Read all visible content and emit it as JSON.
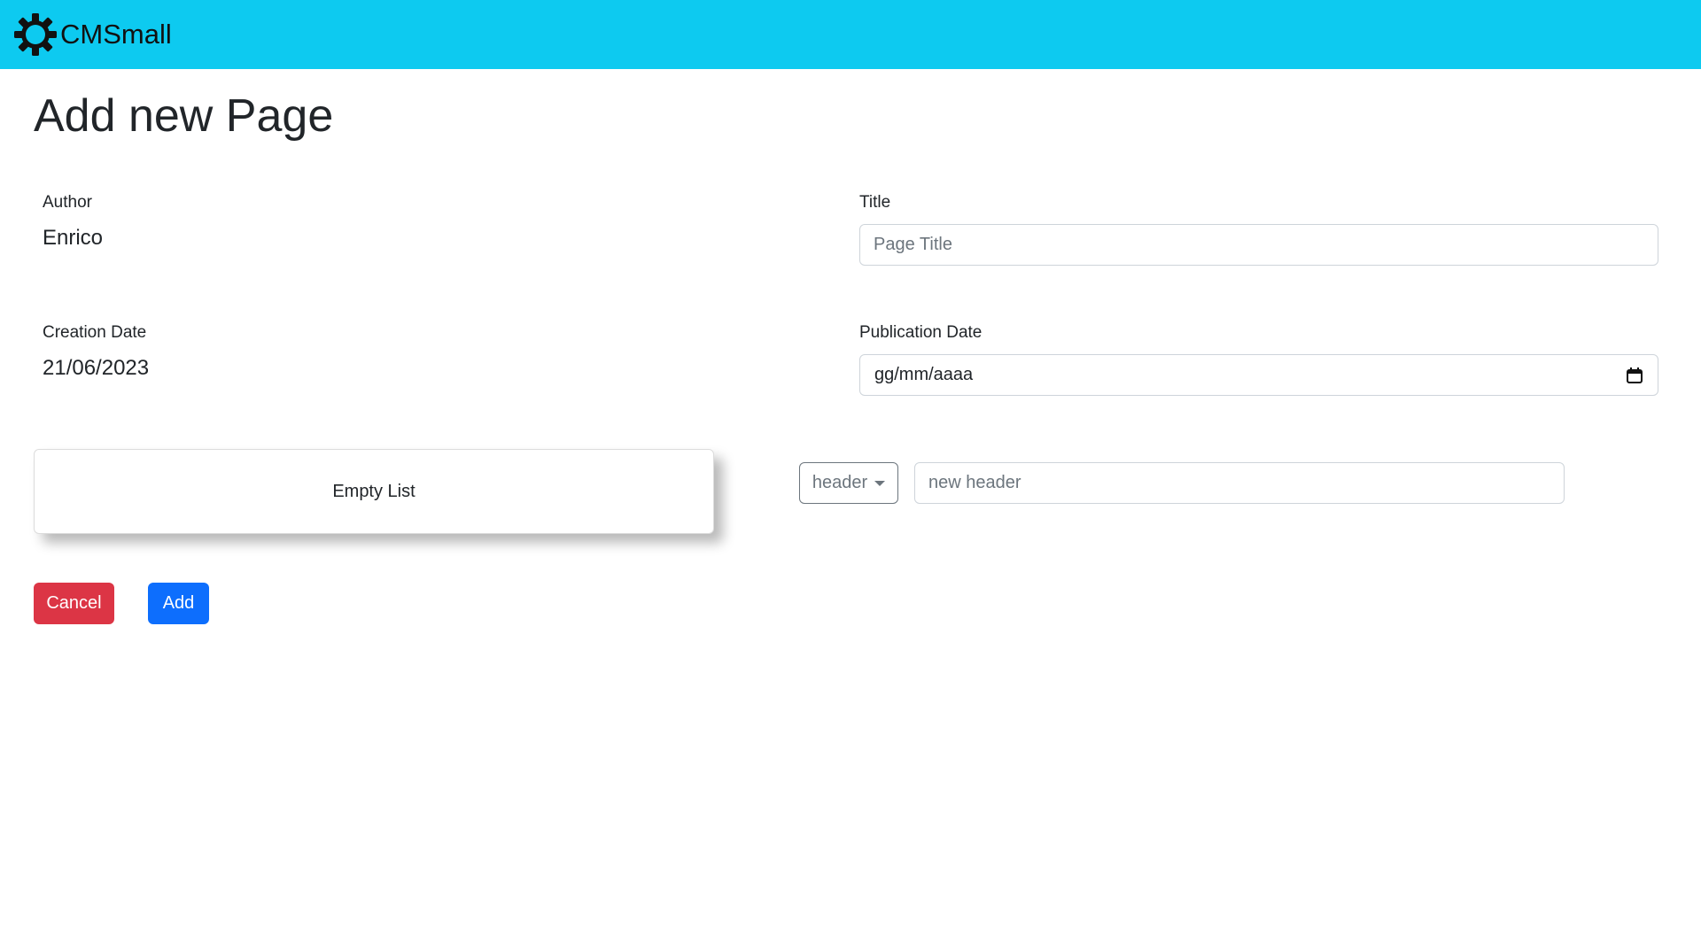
{
  "navbar": {
    "brand": "CMSmall",
    "logo_icon": "gear-icon",
    "background": "#0dcaf0"
  },
  "page": {
    "title": "Add new Page"
  },
  "author": {
    "label": "Author",
    "value": "Enrico"
  },
  "title_field": {
    "label": "Title",
    "placeholder": "Page Title",
    "value": ""
  },
  "creation_date": {
    "label": "Creation Date",
    "value": "21/06/2023"
  },
  "publication_date": {
    "label": "Publication Date",
    "placeholder": "gg/mm/aaaa",
    "icon": "calendar-icon"
  },
  "blocks": {
    "empty_text": "Empty List"
  },
  "new_block": {
    "type_selected": "header",
    "placeholder": "new header",
    "value": ""
  },
  "actions": {
    "cancel_label": "Cancel",
    "add_label": "Add",
    "cancel_color": "#dc3545",
    "add_color": "#0d6efd"
  }
}
